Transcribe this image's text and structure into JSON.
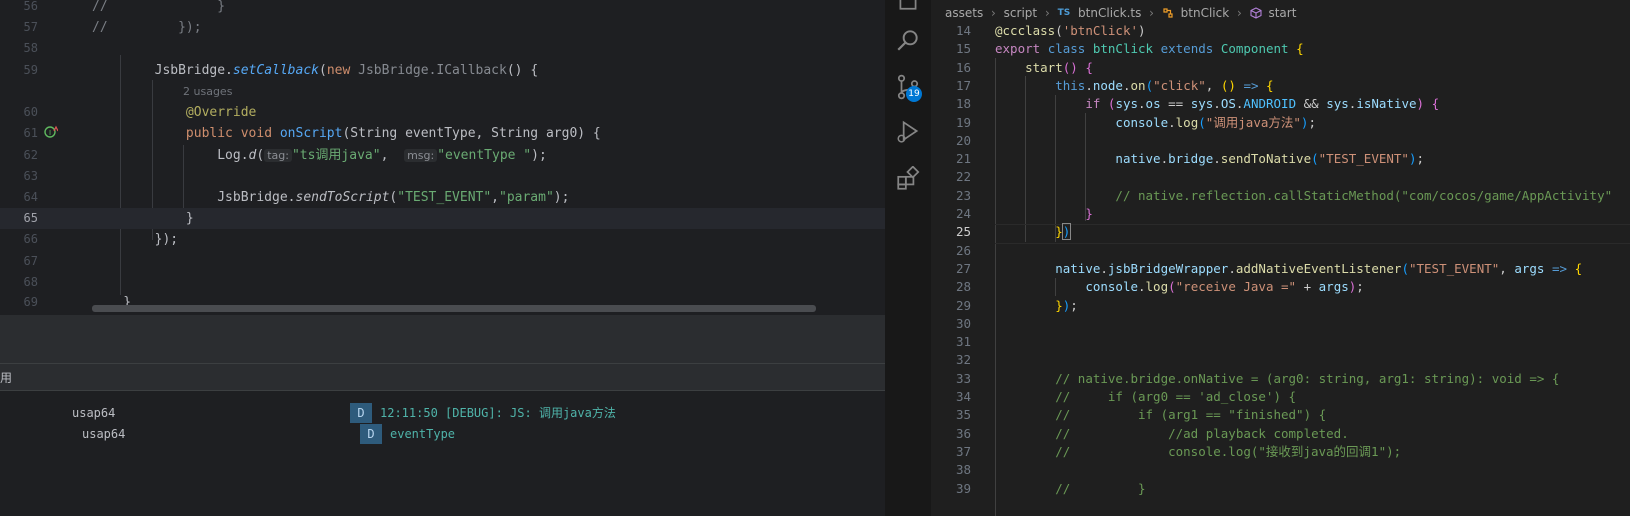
{
  "left_editor": {
    "lines": [
      {
        "num": "56",
        "html": "<span class=\"cm\">//</span>              <span class=\"cm\">}</span>"
      },
      {
        "num": "57",
        "html": "<span class=\"cm\">//         });</span>"
      },
      {
        "num": "58",
        "html": ""
      },
      {
        "num": "59",
        "html": "        JsbBridge.<span class=\"fni\">setCallback</span>(<span class=\"kw\">new</span> <span class=\"dim\">JsbBridge.ICallback</span>() {"
      },
      {
        "num": "",
        "html": "<span class=\"hint\">2 usages</span>"
      },
      {
        "num": "60",
        "html": "            <span class=\"an\">@Override</span>"
      },
      {
        "num": "61",
        "html": "            <span class=\"kw\">public void</span> <span class=\"fn\">onScript</span>(String eventType, String arg0) {"
      },
      {
        "num": "62",
        "html": "                Log.<span class=\"it\">d</span>("
      },
      {
        "num": "63",
        "html": ""
      },
      {
        "num": "64",
        "html": "                JsbBridge.<span class=\"it\">sendToScript</span>(<span class=\"st\">\"TEST_EVENT\"</span>,<span class=\"st\">\"param\"</span>);"
      },
      {
        "num": "65",
        "html": "            }"
      },
      {
        "num": "66",
        "html": "        });"
      },
      {
        "num": "67",
        "html": ""
      },
      {
        "num": "68",
        "html": ""
      },
      {
        "num": "69",
        "html": "    }"
      }
    ],
    "usages_hint": "2 usages",
    "inlay_tag": "tag:",
    "inlay_tag_value": "\"ts调用java\"",
    "inlay_msg": "msg:",
    "inlay_msg_value": "\"eventType \"",
    "current_line": "65"
  },
  "log_panel": {
    "header_label": "用",
    "rows": [
      {
        "process": "usap64",
        "level": "D",
        "message": "12:11:50 [DEBUG]: JS: 调用java方法"
      },
      {
        "process": "usap64",
        "level": "D",
        "message": "eventType"
      }
    ]
  },
  "activity_bar": {
    "source_control_badge": "19",
    "icons": [
      "files-icon",
      "search-icon",
      "source-control-icon",
      "run-debug-icon",
      "extensions-icon"
    ]
  },
  "breadcrumb": {
    "items": [
      "assets",
      "script",
      "btnClick.ts",
      "btnClick",
      "start"
    ],
    "ts_label": "TS"
  },
  "vscode_editor": {
    "current_line": "25",
    "lines": [
      {
        "num": "14",
        "html": "<span class=\"v-dec\">@ccclass</span>(<span class=\"v-str\">'btnClick'</span>)"
      },
      {
        "num": "15",
        "html": "<span class=\"v-kw\">export</span> <span class=\"v-blue\">class</span> <span class=\"v-cls\">btnClick</span> <span class=\"v-blue\">extends</span> <span class=\"v-cls\">Component</span> <span class=\"v-br1\">{</span>"
      },
      {
        "num": "16",
        "html": "    <span class=\"v-fn\">start</span><span class=\"v-br2\">()</span> <span class=\"v-br2\">{</span>"
      },
      {
        "num": "17",
        "html": "        <span class=\"v-blue\">this</span>.<span class=\"v-var\">node</span>.<span class=\"v-fn\">on</span><span class=\"v-br3\">(</span><span class=\"v-str\">\"click\"</span>, <span class=\"v-br1\">()</span> <span class=\"v-blue\">=&gt;</span> <span class=\"v-br1\">{</span>"
      },
      {
        "num": "18",
        "html": "            <span class=\"v-kw\">if</span> <span class=\"v-br2\">(</span><span class=\"v-var\">sys</span>.<span class=\"v-var\">os</span> == <span class=\"v-var\">sys</span>.<span class=\"v-var\">OS</span>.<span class=\"v-const\">ANDROID</span> &amp;&amp; <span class=\"v-var\">sys</span>.<span class=\"v-var\">isNative</span><span class=\"v-br2\">)</span> <span class=\"v-br2\">{</span>"
      },
      {
        "num": "19",
        "html": "                <span class=\"v-var\">console</span>.<span class=\"v-fn\">log</span><span class=\"v-br3\">(</span><span class=\"v-str\">\"调用java方法\"</span><span class=\"v-br3\">)</span>;"
      },
      {
        "num": "20",
        "html": ""
      },
      {
        "num": "21",
        "html": "                <span class=\"v-var\">native</span>.<span class=\"v-var\">bridge</span>.<span class=\"v-fn\">sendToNative</span><span class=\"v-br3\">(</span><span class=\"v-str\">\"TEST_EVENT\"</span><span class=\"v-br3\">)</span>;"
      },
      {
        "num": "22",
        "html": ""
      },
      {
        "num": "23",
        "html": "                <span class=\"v-cm\">// native.reflection.callStaticMethod(\"com/cocos/game/AppActivity\"</span>"
      },
      {
        "num": "24",
        "html": "            <span class=\"v-br2\">}</span>"
      },
      {
        "num": "25",
        "html": "        <span class=\"v-br1\">}</span><span class=\"v-br3 brk\">)</span>"
      },
      {
        "num": "26",
        "html": ""
      },
      {
        "num": "27",
        "html": "        <span class=\"v-var\">native</span>.<span class=\"v-var\">jsbBridgeWrapper</span>.<span class=\"v-fn\">addNativeEventListener</span><span class=\"v-br3\">(</span><span class=\"v-str\">\"TEST_EVENT\"</span>, <span class=\"v-var\">args</span> <span class=\"v-blue\">=&gt;</span> <span class=\"v-br1\">{</span>"
      },
      {
        "num": "28",
        "html": "            <span class=\"v-var\">console</span>.<span class=\"v-fn\">log</span><span class=\"v-br2\">(</span><span class=\"v-str\">\"receive Java =\"</span> + <span class=\"v-var\">args</span><span class=\"v-br2\">)</span>;"
      },
      {
        "num": "29",
        "html": "        <span class=\"v-br1\">}</span><span class=\"v-br3\">)</span>;"
      },
      {
        "num": "30",
        "html": ""
      },
      {
        "num": "31",
        "html": ""
      },
      {
        "num": "32",
        "html": ""
      },
      {
        "num": "33",
        "html": "        <span class=\"v-cm\">// native.bridge.onNative = (arg0: string, arg1: string): void =&gt; {</span>"
      },
      {
        "num": "34",
        "html": "        <span class=\"v-cm\">//     if (arg0 == 'ad_close') {</span>"
      },
      {
        "num": "35",
        "html": "        <span class=\"v-cm\">//         if (arg1 == \"finished\") {</span>"
      },
      {
        "num": "36",
        "html": "        <span class=\"v-cm\">//             //ad playback completed.</span>"
      },
      {
        "num": "37",
        "html": "        <span class=\"v-cm\">//             console.log(\"接收到java的回调1\");</span>"
      },
      {
        "num": "38",
        "html": ""
      },
      {
        "num": "39",
        "html": "        <span class=\"v-cm\">//         }</span>"
      }
    ]
  }
}
